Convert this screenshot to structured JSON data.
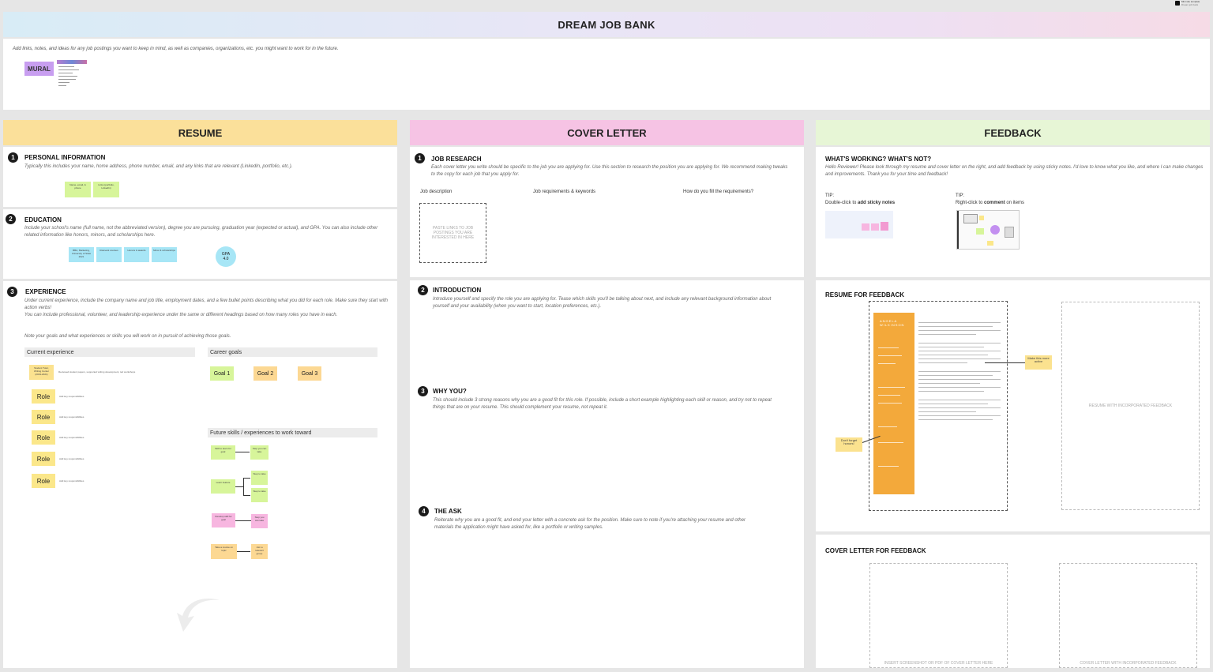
{
  "header": {
    "title": "DREAM JOB BANK"
  },
  "intro": {
    "text": "Add links, notes, and ideas for any job postings you want to keep in mind, as well as companies, organizations, etc. you might want to work for in the future.",
    "logo": "MURAL"
  },
  "top_right": {
    "line1": "Mini site template",
    "line2": "Dream job bank"
  },
  "resume": {
    "title": "RESUME",
    "personal": {
      "num": "1",
      "title": "PERSONAL INFORMATION",
      "desc": "Typically this includes your name, home address, phone number, email, and any links that are relevant (LinkedIn, portfolio, etc.).",
      "stickies": [
        "Name, email, & phone",
        "Links (portfolio, LinkedIn)"
      ]
    },
    "education": {
      "num": "2",
      "title": "EDUCATION",
      "desc": "Include your school's name (full name, not the abbreviated version), degree you are pursuing, graduation year (expected or actual), and GPA. You can also include other related information like honors, minors, and scholarships here.",
      "stickies": [
        "BBA, Marketing, University of State 2021",
        "Relevant courses",
        "Honors & awards",
        "Minor & scholarships"
      ],
      "gpa_label": "GPA",
      "gpa_value": "4.0"
    },
    "experience": {
      "num": "3",
      "title": "EXPERIENCE",
      "desc1": "Under current experience, include the company name and job title, employment dates, and a few bullet points describing what you did for each role. Make sure they start with action verbs!",
      "desc2": "You can include professional, volunteer, and leadership experience under the same or different headings based on how many roles you have in each.",
      "desc3": "Note your goals and what experiences or skills you will work on in pursuit of achieving those goals.",
      "current_label": "Current experience",
      "current_first": "Student Tutor, Writing Center (2019-2021)",
      "current_first_desc": "Reviewed student papers, supported writing development, led workshops",
      "roles": [
        "Role",
        "Role",
        "Role",
        "Role",
        "Role"
      ],
      "role_desc": "Add key responsibilities",
      "career_label": "Career goals",
      "goals": [
        "Goal 1",
        "Goal 2",
        "Goal 3"
      ],
      "future_label": "Future skills / experiences to work toward",
      "future_stickies": [
        "Skill to learn for goal",
        "Step you can take",
        "Learn feature",
        "Step to take",
        "Step to take",
        "Develop skill for goal",
        "Step you can take",
        "Take a course on topic",
        "Join a relevant group"
      ]
    }
  },
  "cover": {
    "title": "COVER LETTER",
    "research": {
      "num": "1",
      "title": "JOB RESEARCH",
      "desc": "Each cover letter you write should be specific to the job you are applying for. Use this section to research the position you are applying for. We recommend making tweaks to the copy for each job that you apply for.",
      "col1": "Job description",
      "col2": "Job requirements & keywords",
      "col3": "How do you fill the requirements?",
      "paste": "PASTE LINKS TO JOB POSTINGS YOU ARE INTERESTED IN HERE"
    },
    "intro": {
      "num": "2",
      "title": "INTRODUCTION",
      "desc": "Introduce yourself and specify the role you are applying for. Tease which skills you'll be talking about next, and include any relevant background information about yourself and your availability (when you want to start, location preferences, etc.)."
    },
    "why": {
      "num": "3",
      "title": "WHY YOU?",
      "desc": "This should include 3 strong reasons why you are a good fit for this role. If possible, include a short example highlighting each skill or reason, and try not to repeat things that are on your resume. This should complement your resume, not repeat it."
    },
    "ask": {
      "num": "4",
      "title": "THE ASK",
      "desc": "Reiterate why you are a good fit, and end your letter with a concrete ask for the position. Make sure to note if you're attaching your resume and other materials the application might have asked for, like a portfolio or writing samples."
    }
  },
  "feedback": {
    "title": "FEEDBACK",
    "working": {
      "title": "WHAT'S WORKING? WHAT'S NOT?",
      "desc": "Hello Reviewer! Please look through my resume and cover letter on the right, and add feedback by using sticky notes. I'd love to know what you like, and where I can make changes and improvements. Thank you for your time and feedback!"
    },
    "tip1": {
      "label": "TIP:",
      "text_prefix": "Double-click to ",
      "text_bold": "add sticky notes"
    },
    "tip2": {
      "label": "TIP:",
      "text_prefix": "Right-click to ",
      "text_bold": "comment",
      "text_suffix": " on items"
    },
    "resume_label": "RESUME FOR FEEDBACK",
    "resume_name": "ANGELA WILKINSON",
    "resume_note1": "Make this more active",
    "resume_note2": "Don't forget honors!",
    "resume_incorporated": "RESUME WITH INCORPORATED FEEDBACK",
    "cover_label": "COVER LETTER FOR FEEDBACK",
    "cover_insert": "INSERT SCREENSHOT OR PDF OF COVER LETTER HERE",
    "cover_incorporated": "COVER LETTER WITH INCORPORATED FEEDBACK"
  }
}
